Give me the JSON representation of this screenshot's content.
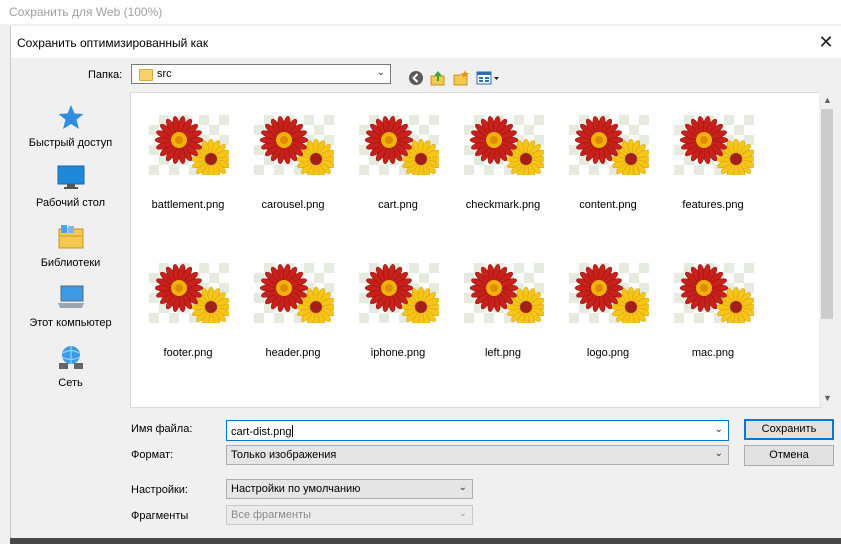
{
  "window": {
    "title": "Сохранить для Web (100%)"
  },
  "dialog": {
    "title": "Сохранить оптимизированный как",
    "close_symbol": "✕"
  },
  "location": {
    "label": "Папка:",
    "folder": "src"
  },
  "toolbar": {
    "icons": [
      "back-icon",
      "up-folder-icon",
      "new-folder-icon",
      "view-menu-icon"
    ]
  },
  "places": [
    {
      "label": "Быстрый доступ",
      "icon": "star-icon"
    },
    {
      "label": "Рабочий стол",
      "icon": "desktop-icon"
    },
    {
      "label": "Библиотеки",
      "icon": "library-icon"
    },
    {
      "label": "Этот компьютер",
      "icon": "computer-icon"
    },
    {
      "label": "Сеть",
      "icon": "network-icon"
    }
  ],
  "files": [
    "battlement.png",
    "carousel.png",
    "cart.png",
    "checkmark.png",
    "content.png",
    "features.png",
    "footer.png",
    "header.png",
    "iphone.png",
    "left.png",
    "logo.png",
    "mac.png"
  ],
  "form": {
    "filename_label": "Имя файла:",
    "filename_value": "cart-dist.png",
    "format_label": "Формат:",
    "format_value": "Только изображения",
    "settings_label": "Настройки:",
    "settings_value": "Настройки по умолчанию",
    "fragments_label": "Фрагменты",
    "fragments_value": "Все фрагменты"
  },
  "buttons": {
    "save": "Сохранить",
    "cancel": "Отмена"
  },
  "colors": {
    "accent": "#0078d7",
    "flower_red": "#c8201a",
    "flower_yellow": "#f5c518"
  }
}
